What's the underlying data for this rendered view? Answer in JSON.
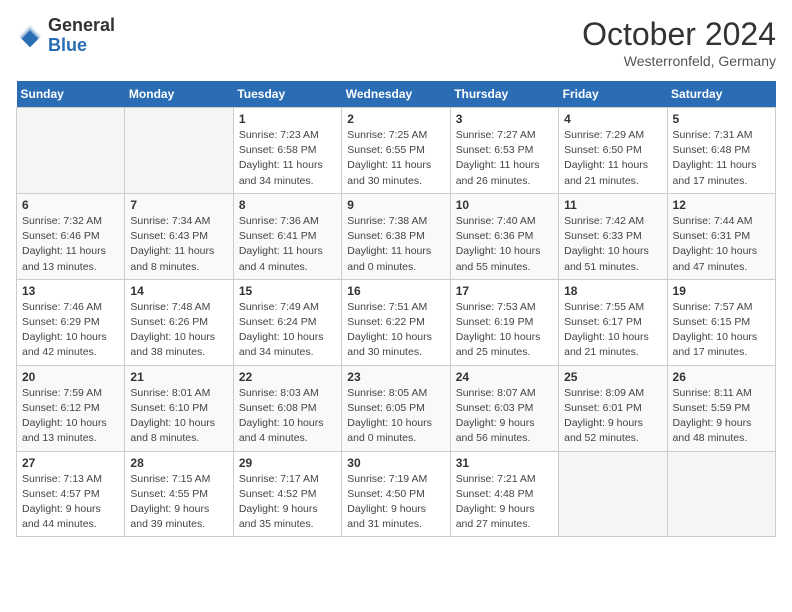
{
  "header": {
    "logo_general": "General",
    "logo_blue": "Blue",
    "month_title": "October 2024",
    "location": "Westerronfeld, Germany"
  },
  "weekdays": [
    "Sunday",
    "Monday",
    "Tuesday",
    "Wednesday",
    "Thursday",
    "Friday",
    "Saturday"
  ],
  "weeks": [
    [
      {
        "day": "",
        "sunrise": "",
        "sunset": "",
        "daylight": ""
      },
      {
        "day": "",
        "sunrise": "",
        "sunset": "",
        "daylight": ""
      },
      {
        "day": "1",
        "sunrise": "Sunrise: 7:23 AM",
        "sunset": "Sunset: 6:58 PM",
        "daylight": "Daylight: 11 hours and 34 minutes."
      },
      {
        "day": "2",
        "sunrise": "Sunrise: 7:25 AM",
        "sunset": "Sunset: 6:55 PM",
        "daylight": "Daylight: 11 hours and 30 minutes."
      },
      {
        "day": "3",
        "sunrise": "Sunrise: 7:27 AM",
        "sunset": "Sunset: 6:53 PM",
        "daylight": "Daylight: 11 hours and 26 minutes."
      },
      {
        "day": "4",
        "sunrise": "Sunrise: 7:29 AM",
        "sunset": "Sunset: 6:50 PM",
        "daylight": "Daylight: 11 hours and 21 minutes."
      },
      {
        "day": "5",
        "sunrise": "Sunrise: 7:31 AM",
        "sunset": "Sunset: 6:48 PM",
        "daylight": "Daylight: 11 hours and 17 minutes."
      }
    ],
    [
      {
        "day": "6",
        "sunrise": "Sunrise: 7:32 AM",
        "sunset": "Sunset: 6:46 PM",
        "daylight": "Daylight: 11 hours and 13 minutes."
      },
      {
        "day": "7",
        "sunrise": "Sunrise: 7:34 AM",
        "sunset": "Sunset: 6:43 PM",
        "daylight": "Daylight: 11 hours and 8 minutes."
      },
      {
        "day": "8",
        "sunrise": "Sunrise: 7:36 AM",
        "sunset": "Sunset: 6:41 PM",
        "daylight": "Daylight: 11 hours and 4 minutes."
      },
      {
        "day": "9",
        "sunrise": "Sunrise: 7:38 AM",
        "sunset": "Sunset: 6:38 PM",
        "daylight": "Daylight: 11 hours and 0 minutes."
      },
      {
        "day": "10",
        "sunrise": "Sunrise: 7:40 AM",
        "sunset": "Sunset: 6:36 PM",
        "daylight": "Daylight: 10 hours and 55 minutes."
      },
      {
        "day": "11",
        "sunrise": "Sunrise: 7:42 AM",
        "sunset": "Sunset: 6:33 PM",
        "daylight": "Daylight: 10 hours and 51 minutes."
      },
      {
        "day": "12",
        "sunrise": "Sunrise: 7:44 AM",
        "sunset": "Sunset: 6:31 PM",
        "daylight": "Daylight: 10 hours and 47 minutes."
      }
    ],
    [
      {
        "day": "13",
        "sunrise": "Sunrise: 7:46 AM",
        "sunset": "Sunset: 6:29 PM",
        "daylight": "Daylight: 10 hours and 42 minutes."
      },
      {
        "day": "14",
        "sunrise": "Sunrise: 7:48 AM",
        "sunset": "Sunset: 6:26 PM",
        "daylight": "Daylight: 10 hours and 38 minutes."
      },
      {
        "day": "15",
        "sunrise": "Sunrise: 7:49 AM",
        "sunset": "Sunset: 6:24 PM",
        "daylight": "Daylight: 10 hours and 34 minutes."
      },
      {
        "day": "16",
        "sunrise": "Sunrise: 7:51 AM",
        "sunset": "Sunset: 6:22 PM",
        "daylight": "Daylight: 10 hours and 30 minutes."
      },
      {
        "day": "17",
        "sunrise": "Sunrise: 7:53 AM",
        "sunset": "Sunset: 6:19 PM",
        "daylight": "Daylight: 10 hours and 25 minutes."
      },
      {
        "day": "18",
        "sunrise": "Sunrise: 7:55 AM",
        "sunset": "Sunset: 6:17 PM",
        "daylight": "Daylight: 10 hours and 21 minutes."
      },
      {
        "day": "19",
        "sunrise": "Sunrise: 7:57 AM",
        "sunset": "Sunset: 6:15 PM",
        "daylight": "Daylight: 10 hours and 17 minutes."
      }
    ],
    [
      {
        "day": "20",
        "sunrise": "Sunrise: 7:59 AM",
        "sunset": "Sunset: 6:12 PM",
        "daylight": "Daylight: 10 hours and 13 minutes."
      },
      {
        "day": "21",
        "sunrise": "Sunrise: 8:01 AM",
        "sunset": "Sunset: 6:10 PM",
        "daylight": "Daylight: 10 hours and 8 minutes."
      },
      {
        "day": "22",
        "sunrise": "Sunrise: 8:03 AM",
        "sunset": "Sunset: 6:08 PM",
        "daylight": "Daylight: 10 hours and 4 minutes."
      },
      {
        "day": "23",
        "sunrise": "Sunrise: 8:05 AM",
        "sunset": "Sunset: 6:05 PM",
        "daylight": "Daylight: 10 hours and 0 minutes."
      },
      {
        "day": "24",
        "sunrise": "Sunrise: 8:07 AM",
        "sunset": "Sunset: 6:03 PM",
        "daylight": "Daylight: 9 hours and 56 minutes."
      },
      {
        "day": "25",
        "sunrise": "Sunrise: 8:09 AM",
        "sunset": "Sunset: 6:01 PM",
        "daylight": "Daylight: 9 hours and 52 minutes."
      },
      {
        "day": "26",
        "sunrise": "Sunrise: 8:11 AM",
        "sunset": "Sunset: 5:59 PM",
        "daylight": "Daylight: 9 hours and 48 minutes."
      }
    ],
    [
      {
        "day": "27",
        "sunrise": "Sunrise: 7:13 AM",
        "sunset": "Sunset: 4:57 PM",
        "daylight": "Daylight: 9 hours and 44 minutes."
      },
      {
        "day": "28",
        "sunrise": "Sunrise: 7:15 AM",
        "sunset": "Sunset: 4:55 PM",
        "daylight": "Daylight: 9 hours and 39 minutes."
      },
      {
        "day": "29",
        "sunrise": "Sunrise: 7:17 AM",
        "sunset": "Sunset: 4:52 PM",
        "daylight": "Daylight: 9 hours and 35 minutes."
      },
      {
        "day": "30",
        "sunrise": "Sunrise: 7:19 AM",
        "sunset": "Sunset: 4:50 PM",
        "daylight": "Daylight: 9 hours and 31 minutes."
      },
      {
        "day": "31",
        "sunrise": "Sunrise: 7:21 AM",
        "sunset": "Sunset: 4:48 PM",
        "daylight": "Daylight: 9 hours and 27 minutes."
      },
      {
        "day": "",
        "sunrise": "",
        "sunset": "",
        "daylight": ""
      },
      {
        "day": "",
        "sunrise": "",
        "sunset": "",
        "daylight": ""
      }
    ]
  ]
}
